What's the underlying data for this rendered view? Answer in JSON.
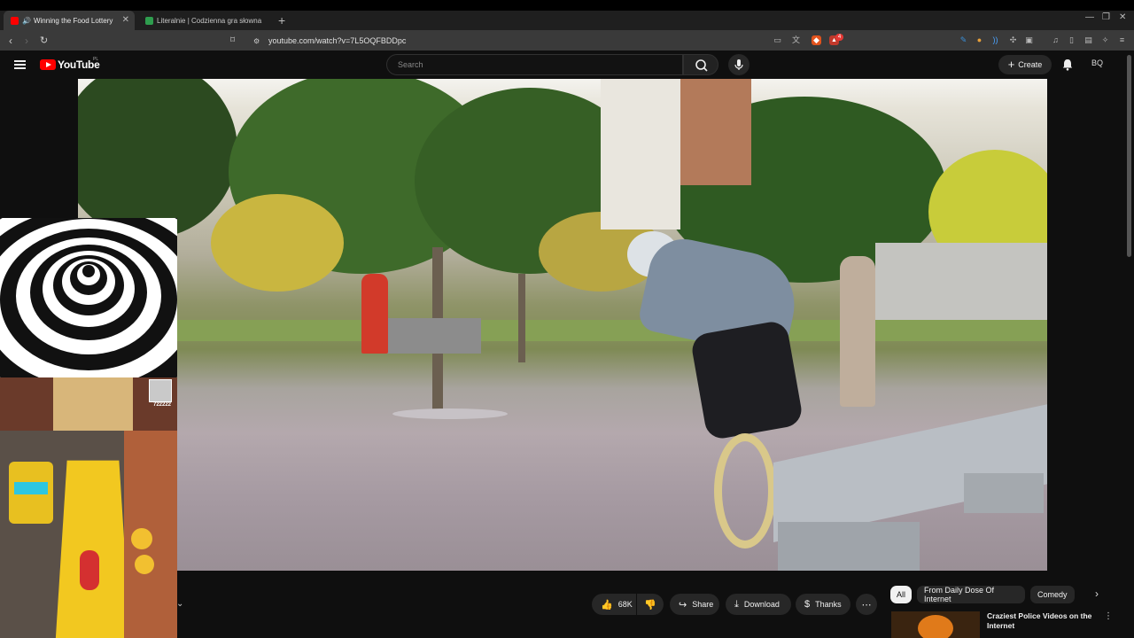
{
  "browser": {
    "tabs": [
      {
        "title": "Winning the Food Lottery",
        "active": true
      },
      {
        "title": "Literalnie | Codzienna gra słowna",
        "active": false
      }
    ],
    "url": "youtube.com/watch?v=7L5OQFBDDpc",
    "badge_count": "4"
  },
  "header": {
    "logo_text": "YouTube",
    "country_code": "PL",
    "search_placeholder": "Search",
    "create_label": "Create",
    "avatar_initials": "BQ"
  },
  "game_overlay": {
    "score": "722222"
  },
  "actions": {
    "like_count": "68K",
    "share_label": "Share",
    "download_label": "Download",
    "thanks_label": "Thanks"
  },
  "chips": [
    "All",
    "From Daily Dose Of Internet",
    "Comedy"
  ],
  "recommendation": {
    "title": "Craziest Police Videos on the Internet"
  },
  "colors": {
    "brand": "#ff0000",
    "background": "#0f0f0f",
    "chip_selected": "#f1f1f1"
  }
}
